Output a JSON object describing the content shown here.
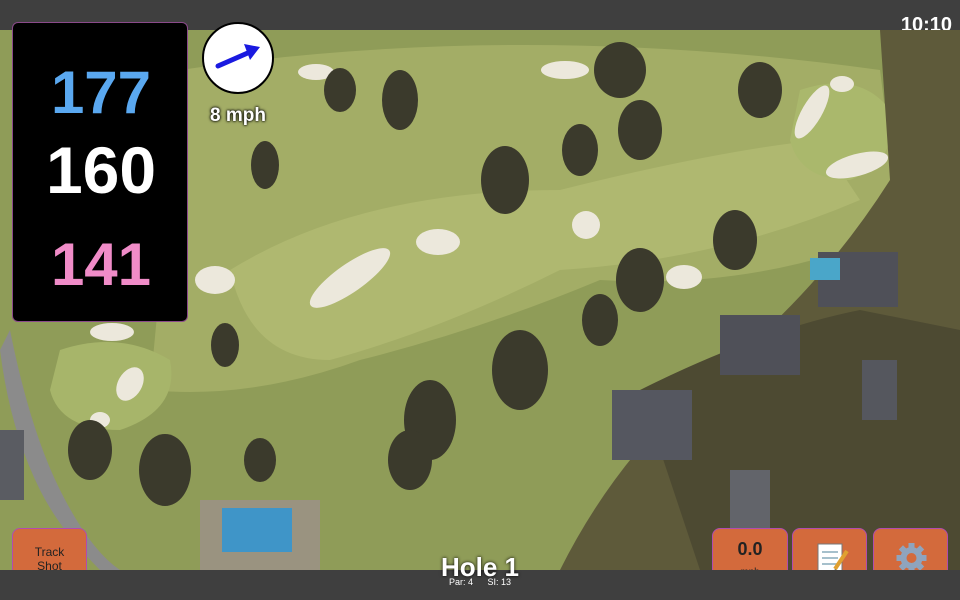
{
  "status": {
    "time": "10:10"
  },
  "distances": {
    "back": "177",
    "middle": "160",
    "front": "141"
  },
  "wind": {
    "speed": "8 mph",
    "direction_icon": "wind-arrow-icon"
  },
  "buttons": {
    "track_shot": "Track\nShot",
    "notes_icon": "notes-icon",
    "settings_icon": "gear-icon"
  },
  "speed": {
    "value": "0.0",
    "unit": "mph"
  },
  "hole": {
    "title": "Hole 1",
    "par": "Par: 4",
    "si": "SI: 13"
  },
  "colors": {
    "back": "#5aa8f0",
    "middle": "#ffffff",
    "front": "#f08cc8",
    "button": "#d36a3c"
  }
}
